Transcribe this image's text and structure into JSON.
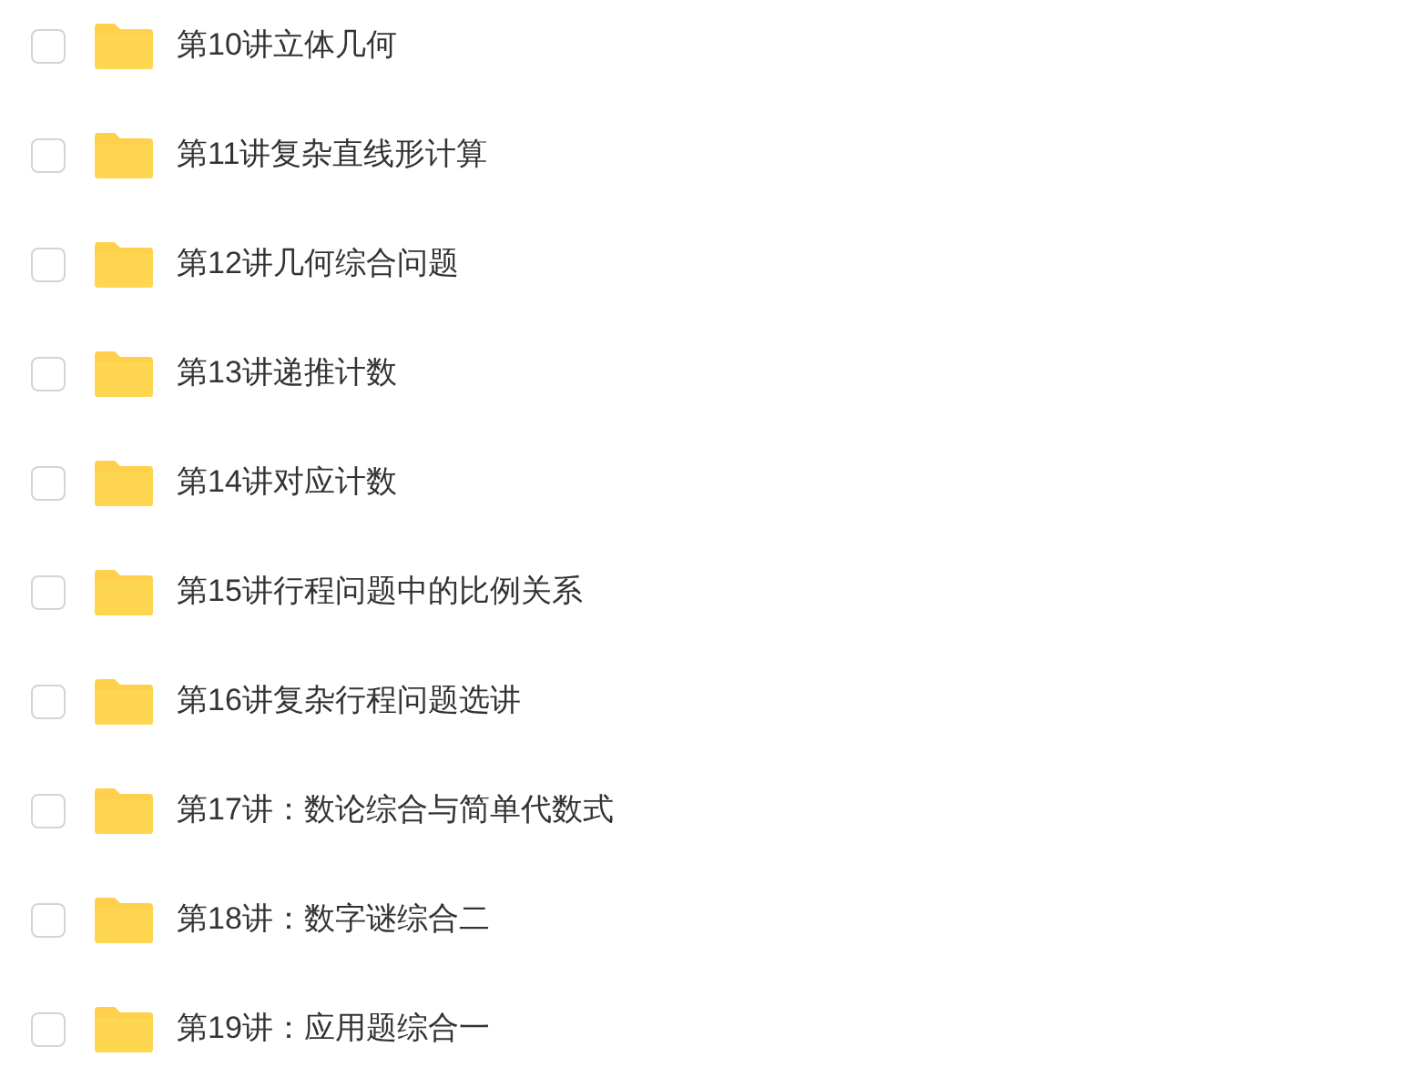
{
  "folders": [
    {
      "name": "第10讲立体几何",
      "checked": false
    },
    {
      "name": "第11讲复杂直线形计算",
      "checked": false
    },
    {
      "name": "第12讲几何综合问题",
      "checked": false
    },
    {
      "name": "第13讲递推计数",
      "checked": false
    },
    {
      "name": "第14讲对应计数",
      "checked": false
    },
    {
      "name": "第15讲行程问题中的比例关系",
      "checked": false
    },
    {
      "name": "第16讲复杂行程问题选讲",
      "checked": false
    },
    {
      "name": "第17讲：数论综合与简单代数式",
      "checked": false
    },
    {
      "name": "第18讲：数字谜综合二",
      "checked": false
    },
    {
      "name": "第19讲：应用题综合一",
      "checked": false
    }
  ]
}
